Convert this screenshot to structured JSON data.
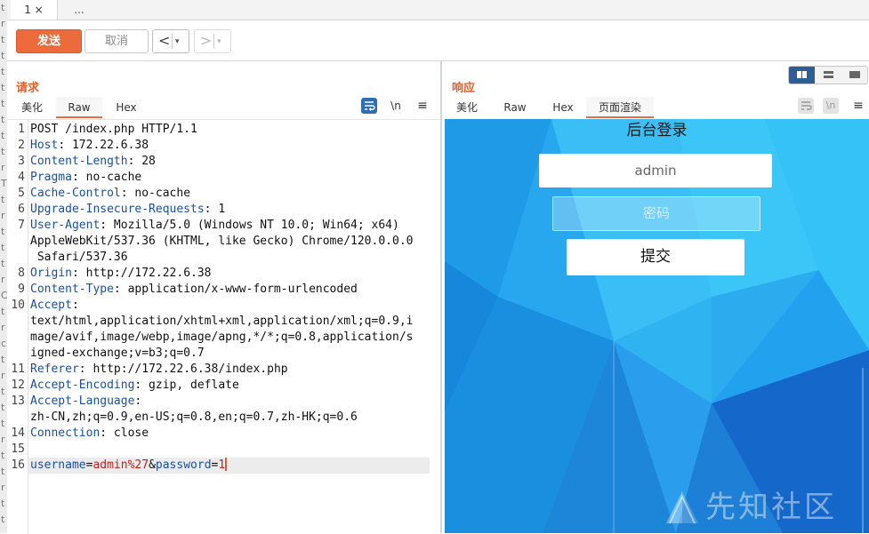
{
  "tabs": {
    "active_tab": "1 ×",
    "more_tab": "..."
  },
  "toolbar": {
    "send_label": "发送",
    "cancel_label": "取消",
    "back_arrow": "<",
    "forward_arrow": ">",
    "dropdown_glyph": "▾"
  },
  "request": {
    "title": "请求",
    "subtabs": [
      "美化",
      "Raw",
      "Hex"
    ],
    "active_subtab": "Raw",
    "icons": {
      "wrap": "wrap-lines-icon",
      "newline": "\\n",
      "menu": "≡"
    },
    "lines": [
      {
        "num": "1",
        "name": "",
        "value": "POST /index.php HTTP/1.1"
      },
      {
        "num": "2",
        "name": "Host",
        "value": ": 172.22.6.38"
      },
      {
        "num": "3",
        "name": "Content-Length",
        "value": ": 28"
      },
      {
        "num": "4",
        "name": "Pragma",
        "value": ": no-cache"
      },
      {
        "num": "5",
        "name": "Cache-Control",
        "value": ": no-cache"
      },
      {
        "num": "6",
        "name": "Upgrade-Insecure-Requests",
        "value": ": 1"
      },
      {
        "num": "7",
        "name": "User-Agent",
        "value": ": Mozilla/5.0 (Windows NT 10.0; Win64; x64)"
      },
      {
        "num": "",
        "name": "",
        "value": "AppleWebKit/537.36 (KHTML, like Gecko) Chrome/120.0.0.0"
      },
      {
        "num": "",
        "name": "",
        "value": " Safari/537.36"
      },
      {
        "num": "8",
        "name": "Origin",
        "value": ": http://172.22.6.38"
      },
      {
        "num": "9",
        "name": "Content-Type",
        "value": ": application/x-www-form-urlencoded"
      },
      {
        "num": "10",
        "name": "Accept",
        "value": ":"
      },
      {
        "num": "",
        "name": "",
        "value": "text/html,application/xhtml+xml,application/xml;q=0.9,i"
      },
      {
        "num": "",
        "name": "",
        "value": "mage/avif,image/webp,image/apng,*/*;q=0.8,application/s"
      },
      {
        "num": "",
        "name": "",
        "value": "igned-exchange;v=b3;q=0.7"
      },
      {
        "num": "11",
        "name": "Referer",
        "value": ": http://172.22.6.38/index.php"
      },
      {
        "num": "12",
        "name": "Accept-Encoding",
        "value": ": gzip, deflate"
      },
      {
        "num": "13",
        "name": "Accept-Language",
        "value": ":"
      },
      {
        "num": "",
        "name": "",
        "value": "zh-CN,zh;q=0.9,en-US;q=0.8,en;q=0.7,zh-HK;q=0.6"
      },
      {
        "num": "14",
        "name": "Connection",
        "value": ": close"
      },
      {
        "num": "15",
        "name": "",
        "value": ""
      }
    ],
    "body_line": {
      "num": "16",
      "param1_name": "username",
      "eq1": "=",
      "param1_value": "admin%27",
      "amp": "&",
      "param2_name": "password",
      "eq2": "=",
      "param2_value": "1"
    }
  },
  "response": {
    "title": "响应",
    "subtabs": [
      "美化",
      "Raw",
      "Hex",
      "页面渲染"
    ],
    "active_subtab": "页面渲染",
    "render": {
      "page_title": "后台登录",
      "username_value": "admin",
      "password_placeholder": "密码",
      "submit_label": "提交"
    },
    "watermark": "先知社区"
  },
  "background_sliver_glyphs": [
    "t",
    "r",
    "t",
    "t",
    "t",
    "t",
    "t",
    "t",
    "t",
    "t",
    "r",
    "T",
    "t",
    "r",
    "t",
    "t",
    "t",
    "r",
    "C",
    "t",
    "r",
    "c",
    "t",
    "r",
    "t",
    "t",
    "t",
    "r",
    "t",
    "t",
    "r",
    "t",
    "t",
    "r"
  ],
  "colors": {
    "accent": "#ec6b3d",
    "header_name": "#1a4fa3",
    "param_value": "#c8201b",
    "render_bg": "#2ab3f0",
    "layout_active": "#2d5e99"
  }
}
